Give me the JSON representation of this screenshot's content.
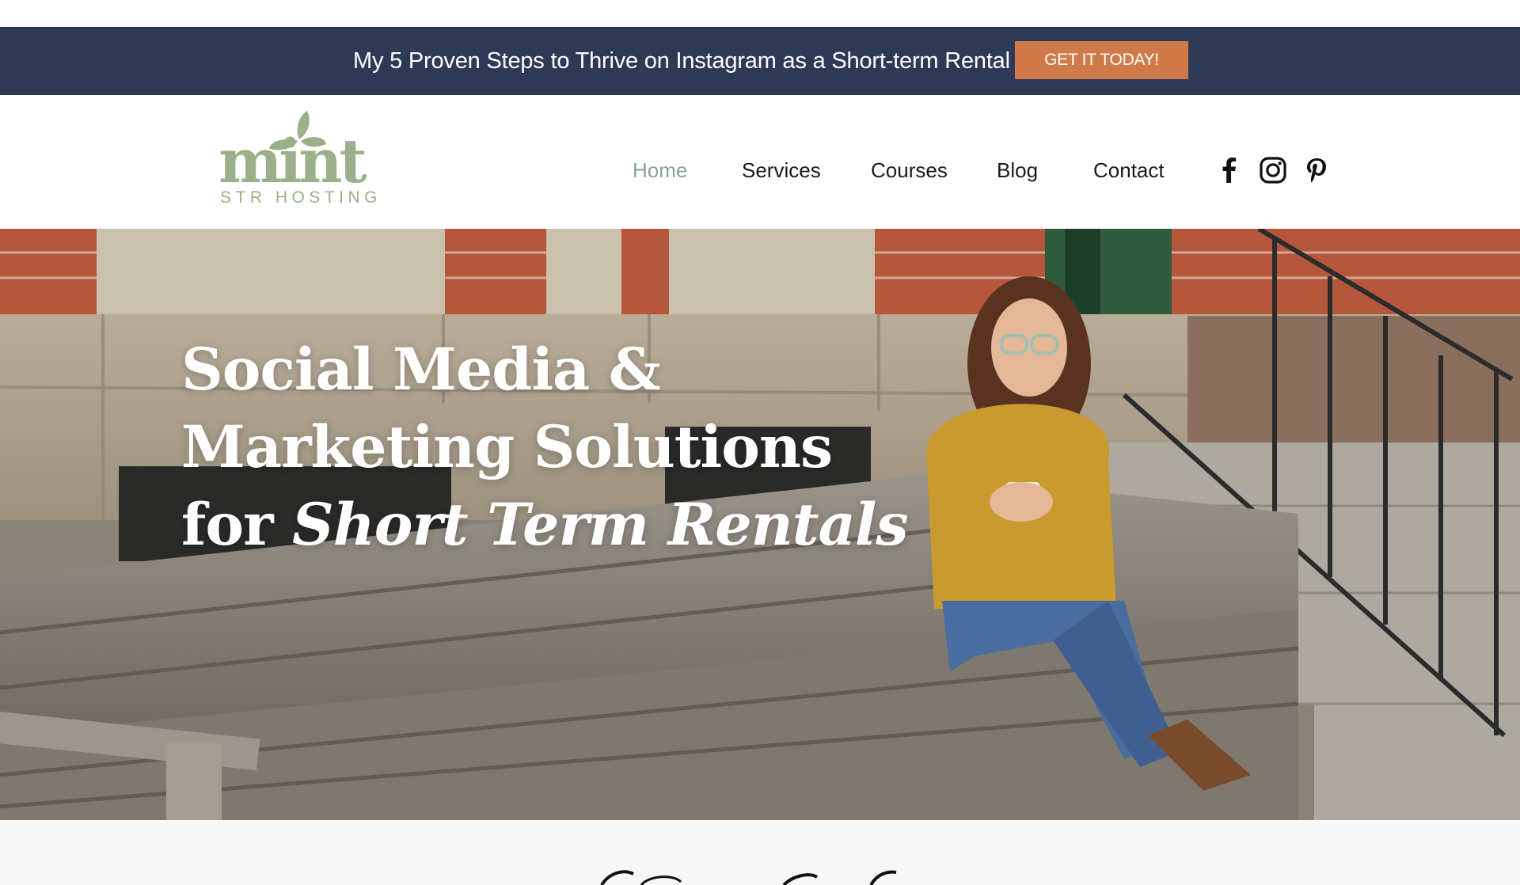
{
  "promo": {
    "text": "My 5 Proven Steps to Thrive on Instagram as a Short-term Rental",
    "cta_label": "GET IT TODAY!"
  },
  "brand": {
    "logo_word": "mint",
    "logo_sub": "STR HOSTING",
    "color": "#9bb08a"
  },
  "nav": {
    "items": [
      {
        "label": "Home",
        "active": true
      },
      {
        "label": "Services"
      },
      {
        "label": "Courses"
      },
      {
        "label": "Blog"
      },
      {
        "label": "Contact"
      }
    ],
    "active_color": "#8aa58f"
  },
  "social": {
    "icons": [
      "facebook-icon",
      "instagram-icon",
      "pinterest-icon"
    ]
  },
  "hero": {
    "line1": "Social Media &",
    "line2": "Marketing Solutions",
    "line3_prefix": "for",
    "line3_emphasis": "Short Term Rentals"
  },
  "colors": {
    "promo_bg": "#2e3a55",
    "cta_bg": "#d07a4a",
    "text_dark": "#1a1a1a"
  }
}
